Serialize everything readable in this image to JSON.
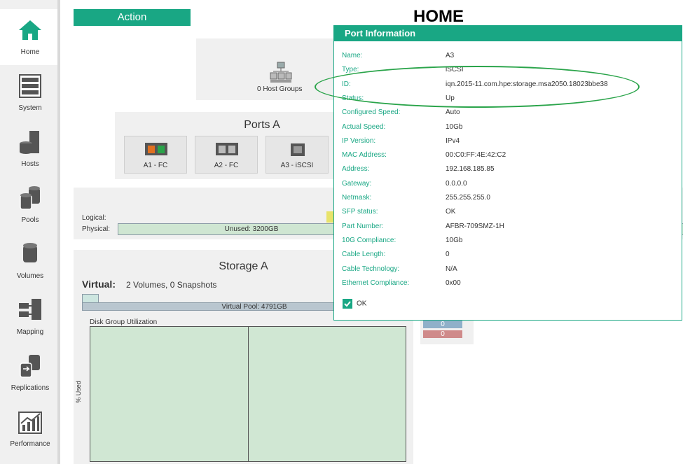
{
  "sidebar": {
    "items": [
      {
        "label": "Home",
        "icon": "home-icon"
      },
      {
        "label": "System",
        "icon": "system-icon"
      },
      {
        "label": "Hosts",
        "icon": "hosts-icon"
      },
      {
        "label": "Pools",
        "icon": "pools-icon"
      },
      {
        "label": "Volumes",
        "icon": "volumes-icon"
      },
      {
        "label": "Mapping",
        "icon": "mapping-icon"
      },
      {
        "label": "Replications",
        "icon": "replications-icon"
      },
      {
        "label": "Performance",
        "icon": "performance-icon"
      }
    ]
  },
  "action": {
    "label": "Action"
  },
  "page": {
    "title": "HOME"
  },
  "hosts": {
    "groups_label": "0 Host Groups"
  },
  "ports": {
    "title": "Ports A",
    "tiles": [
      {
        "label": "A1 - FC"
      },
      {
        "label": "A2 - FC"
      },
      {
        "label": "A3 - iSCSI"
      }
    ]
  },
  "capacity": {
    "logical_label": "Logical:",
    "physical_label": "Physical:",
    "unused_label": "Unused: 3200GB"
  },
  "storage": {
    "title": "Storage A",
    "virtual_label": "Virtual:",
    "virtual_summary": "2 Volumes, 0 Snapshots",
    "pool_label": "Virtual Pool: 4791GB",
    "dg_label": "Disk Group Utilization",
    "y_label": "% Used",
    "counter_blue": "0",
    "counter_red": "0"
  },
  "dialog": {
    "title": "Port Information",
    "ok_label": "OK",
    "fields": [
      {
        "k": "Name:",
        "v": "A3"
      },
      {
        "k": "Type:",
        "v": "iSCSI"
      },
      {
        "k": "ID:",
        "v": "iqn.2015-11.com.hpe:storage.msa2050.18023bbe38"
      },
      {
        "k": "Status:",
        "v": "Up"
      },
      {
        "k": "Configured Speed:",
        "v": "Auto"
      },
      {
        "k": "Actual Speed:",
        "v": "10Gb"
      },
      {
        "k": "IP Version:",
        "v": "IPv4"
      },
      {
        "k": "MAC Address:",
        "v": "00:C0:FF:4E:42:C2"
      },
      {
        "k": "Address:",
        "v": "192.168.185.85"
      },
      {
        "k": "Gateway:",
        "v": "0.0.0.0"
      },
      {
        "k": "Netmask:",
        "v": "255.255.255.0"
      },
      {
        "k": "SFP status:",
        "v": "OK"
      },
      {
        "k": "Part Number:",
        "v": "AFBR-709SMZ-1H"
      },
      {
        "k": "10G Compliance:",
        "v": "10Gb"
      },
      {
        "k": "Cable Length:",
        "v": "0"
      },
      {
        "k": "Cable Technology:",
        "v": "N/A"
      },
      {
        "k": "Ethernet Compliance:",
        "v": "0x00"
      }
    ]
  },
  "colors": {
    "accent": "#19a784",
    "highlight": "#2aa44a"
  }
}
